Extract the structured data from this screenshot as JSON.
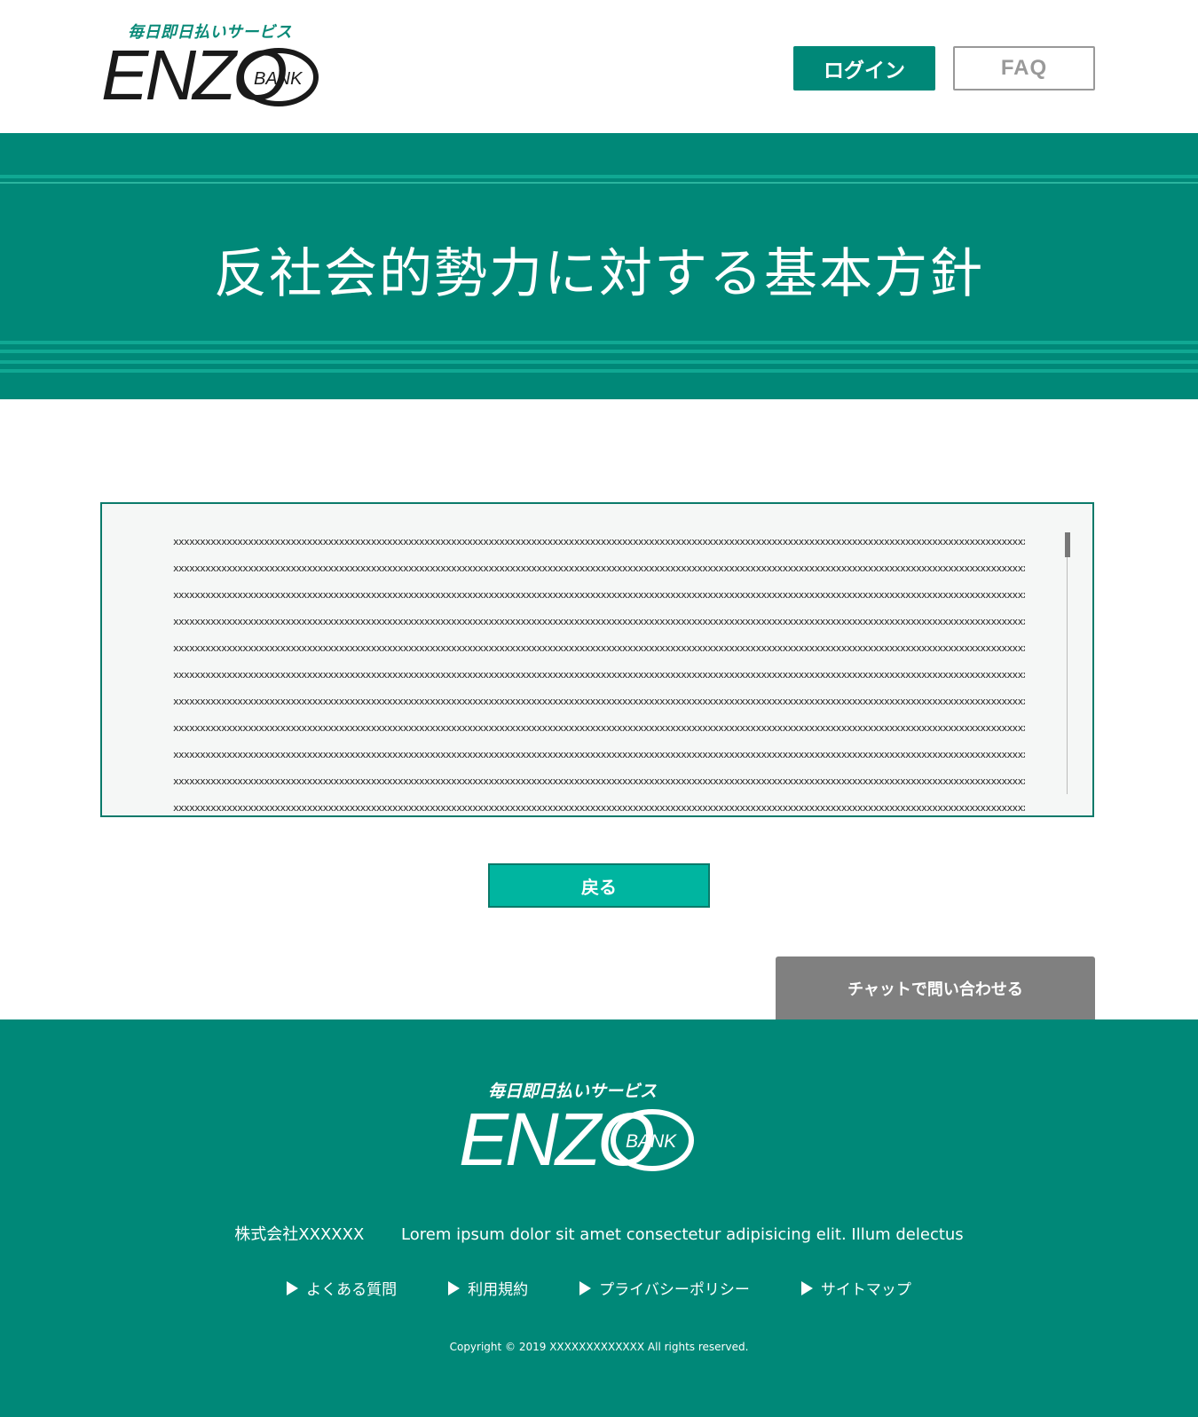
{
  "header": {
    "tagline": "毎日即日払いサービス",
    "logo_text": "ENZO",
    "logo_badge": "BANK",
    "login_label": "ログイン",
    "faq_label": "FAQ"
  },
  "banner": {
    "title": "反社会的勢力に対する基本方針"
  },
  "content": {
    "lines": [
      "xxxxxxxxxxxxxxxxxxxxxxxxxxxxxxxxxxxxxxxxxxxxxxxxxxxxxxxxxxxxxxxxxxxxxxxxxxxxxxxxxxxxxxxxxxxxxxxxxxxxxxxxxxxxxxxxxxxxxxxxxxxxxxxxxxxxxxxxxxxxxxxxxxxxxxxxxxxxxxxxxxx",
      "xxxxxxxxxxxxxxxxxxxxxxxxxxxxxxxxxxxxxxxxxxxxxxxxxxxxxxxxxxxxxxxxxxxxxxxxxxxxxxxxxxxxxxxxxxxxxxxxxxxxxxxxxxxxxxxxxxxxxxxxxxxxxxxxxxxxxxxxxxxxxxxxxxxxxxxxxxxxxxxxxxx",
      "xxxxxxxxxxxxxxxxxxxxxxxxxxxxxxxxxxxxxxxxxxxxxxxxxxxxxxxxxxxxxxxxxxxxxxxxxxxxxxxxxxxxxxxxxxxxxxxxxxxxxxxxxxxxxxxxxxxxxxxxxxxxxxxxxxxxxxxxxxxxxxxxxxxxxxxxxxxxxxxxxxx",
      "xxxxxxxxxxxxxxxxxxxxxxxxxxxxxxxxxxxxxxxxxxxxxxxxxxxxxxxxxxxxxxxxxxxxxxxxxxxxxxxxxxxxxxxxxxxxxxxxxxxxxxxxxxxxxxxxxxxxxxxxxxxxxxxxxxxxxxxxxxxxxxxxxxxxxxxxxxxxxxxxxxx",
      "xxxxxxxxxxxxxxxxxxxxxxxxxxxxxxxxxxxxxxxxxxxxxxxxxxxxxxxxxxxxxxxxxxxxxxxxxxxxxxxxxxxxxxxxxxxxxxxxxxxxxxxxxxxxxxxxxxxxxxxxxxxxxxxxxxxxxxxxxxxxxxxxxxxxxxxxxxxxxxxxxxx",
      "xxxxxxxxxxxxxxxxxxxxxxxxxxxxxxxxxxxxxxxxxxxxxxxxxxxxxxxxxxxxxxxxxxxxxxxxxxxxxxxxxxxxxxxxxxxxxxxxxxxxxxxxxxxxxxxxxxxxxxxxxxxxxxxxxxxxxxxxxxxxxxxxxxxxxxxxxxxxxxxxxxx",
      "xxxxxxxxxxxxxxxxxxxxxxxxxxxxxxxxxxxxxxxxxxxxxxxxxxxxxxxxxxxxxxxxxxxxxxxxxxxxxxxxxxxxxxxxxxxxxxxxxxxxxxxxxxxxxxxxxxxxxxxxxxxxxxxxxxxxxxxxxxxxxxxxxxxxxxxxxxxxxxxxxxx",
      "xxxxxxxxxxxxxxxxxxxxxxxxxxxxxxxxxxxxxxxxxxxxxxxxxxxxxxxxxxxxxxxxxxxxxxxxxxxxxxxxxxxxxxxxxxxxxxxxxxxxxxxxxxxxxxxxxxxxxxxxxxxxxxxxxxxxxxxxxxxxxxxxxxxxxxxxxxxxxxxxxxx",
      "xxxxxxxxxxxxxxxxxxxxxxxxxxxxxxxxxxxxxxxxxxxxxxxxxxxxxxxxxxxxxxxxxxxxxxxxxxxxxxxxxxxxxxxxxxxxxxxxxxxxxxxxxxxxxxxxxxxxxxxxxxxxxxxxxxxxxxxxxxxxxxxxxxxxxxxxxxxxxxxxxxx",
      "xxxxxxxxxxxxxxxxxxxxxxxxxxxxxxxxxxxxxxxxxxxxxxxxxxxxxxxxxxxxxxxxxxxxxxxxxxxxxxxxxxxxxxxxxxxxxxxxxxxxxxxxxxxxxxxxxxxxxxxxxxxxxxxxxxxxxxxxxxxxxxxxxxxxxxxxxxxxxxxxxxx",
      "xxxxxxxxxxxxxxxxxxxxxxxxxxxxxxxxxxxxxxxxxxxxxxxxxxxxxxxxxxxxxxxxxxxxxxxxxxxxxxxxxxxxxxxxxxxxxxxxxxxxxxxxxxxxxxxxxxxxxxxxxxxxxxxxxxxxxxxxxxxxxxxxxxxxxxxxxxxxxxxxxxx"
    ],
    "back_label": "戻る"
  },
  "chat": {
    "label": "チャットで問い合わせる"
  },
  "footer": {
    "tagline": "毎日即日払いサービス",
    "logo_text": "ENZO",
    "logo_badge": "BANK",
    "company_name": "株式会社XXXXXX",
    "company_desc": "Lorem ipsum dolor sit amet consectetur adipisicing elit. Illum delectus",
    "links": [
      {
        "label": "よくある質問"
      },
      {
        "label": "利用規約"
      },
      {
        "label": "プライバシーポリシー"
      },
      {
        "label": "サイトマップ"
      }
    ],
    "copyright": "Copyright © 2019 XXXXXXXXXXXXX All rights reserved."
  },
  "colors": {
    "brand_green": "#008878",
    "accent_teal": "#00b5a0",
    "chat_gray": "#808080"
  },
  "icons": {
    "link_marker": "triangle-right-icon",
    "scroll": "scrollbar"
  }
}
